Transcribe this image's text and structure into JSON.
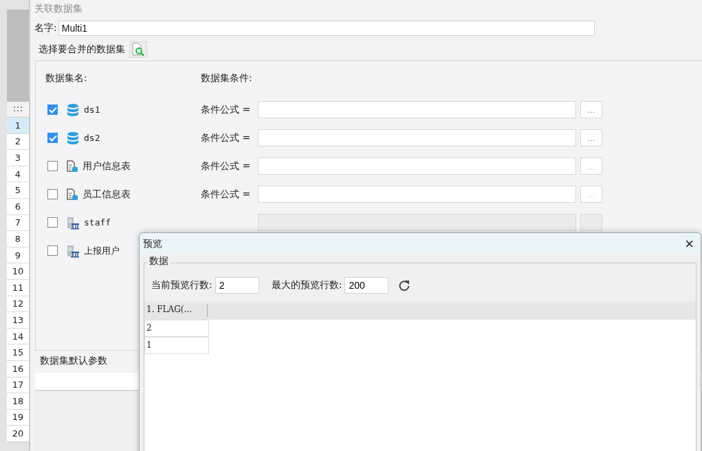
{
  "sheet": {
    "rows": [
      {
        "label": "1",
        "selected": true
      },
      {
        "label": "2",
        "selected": false
      },
      {
        "label": "3",
        "selected": false
      },
      {
        "label": "4",
        "selected": false
      },
      {
        "label": "5",
        "selected": false
      },
      {
        "label": "6",
        "selected": false
      },
      {
        "label": "7",
        "selected": false
      },
      {
        "label": "8",
        "selected": false
      },
      {
        "label": "9",
        "selected": false
      },
      {
        "label": "10",
        "selected": false
      },
      {
        "label": "11",
        "selected": false
      },
      {
        "label": "12",
        "selected": false
      },
      {
        "label": "13",
        "selected": false
      },
      {
        "label": "14",
        "selected": false
      },
      {
        "label": "15",
        "selected": false
      },
      {
        "label": "16",
        "selected": false
      },
      {
        "label": "17",
        "selected": false
      },
      {
        "label": "18",
        "selected": false
      },
      {
        "label": "19",
        "selected": false
      },
      {
        "label": "20",
        "selected": false
      }
    ]
  },
  "window": {
    "title": "关联数据集",
    "name_label": "名字:",
    "name_value": "Multi1",
    "select_label": "选择要合并的数据集",
    "columns": [
      "数据集名:",
      "数据集条件:"
    ],
    "datasets": [
      {
        "kind": "dataset",
        "name": "ds1",
        "checked": true,
        "condition": {
          "label": "条件公式 =",
          "button": "...",
          "disabled": false
        }
      },
      {
        "kind": "dataset",
        "name": "ds2",
        "checked": true,
        "condition": {
          "label": "条件公式 =",
          "button": "...",
          "disabled": false
        }
      },
      {
        "kind": "table",
        "name": "用户信息表",
        "checked": false,
        "condition": {
          "label": "条件公式 =",
          "button": "...",
          "disabled": true
        }
      },
      {
        "kind": "table",
        "name": "员工信息表",
        "checked": false,
        "condition": {
          "label": "条件公式 =",
          "button": "...",
          "disabled": true
        }
      },
      {
        "kind": "server",
        "name": "staff",
        "checked": false,
        "condition_field": true
      },
      {
        "kind": "server",
        "name": "上报用户",
        "checked": false
      }
    ],
    "params_label": "数据集默认参数"
  },
  "preview": {
    "title": "预览",
    "close": "×",
    "group": "数据",
    "current_label": "当前预览行数:",
    "current_value": "2",
    "max_label": "最大的预览行数:",
    "max_value": "200",
    "table": {
      "columns": [
        "1.  FLAG(..."
      ],
      "rows": [
        [
          "2"
        ],
        [
          "1"
        ]
      ]
    }
  }
}
